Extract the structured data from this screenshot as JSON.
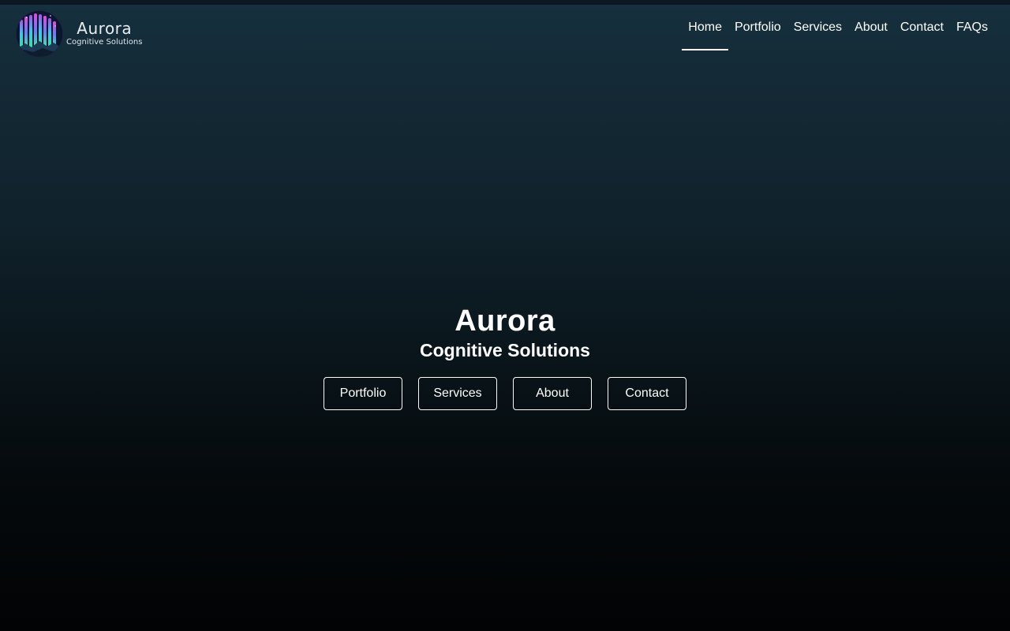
{
  "logo": {
    "name": "Aurora",
    "tagline": "Cognitive Solutions"
  },
  "nav": {
    "items": [
      {
        "label": "Home",
        "active": true
      },
      {
        "label": "Portfolio",
        "active": false
      },
      {
        "label": "Services",
        "active": false
      },
      {
        "label": "About",
        "active": false
      },
      {
        "label": "Contact",
        "active": false
      },
      {
        "label": "FAQs",
        "active": false
      }
    ]
  },
  "hero": {
    "title": "Aurora",
    "subtitle": "Cognitive Solutions",
    "buttons": [
      {
        "label": "Portfolio"
      },
      {
        "label": "Services"
      },
      {
        "label": "About"
      },
      {
        "label": "Contact"
      }
    ]
  },
  "colors": {
    "background_top": "#16303f",
    "background_bottom": "#020304",
    "text": "#ffffff"
  }
}
